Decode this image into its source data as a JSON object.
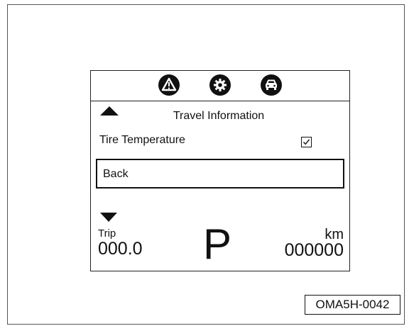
{
  "display": {
    "top_icons": [
      {
        "icon": "warning-triangle-icon"
      },
      {
        "icon": "gear-settings-icon"
      },
      {
        "icon": "car-icon"
      }
    ],
    "menu_title": "Travel Information",
    "items": [
      {
        "label": "Tire Temperature",
        "checked": true
      },
      {
        "label": "Back"
      }
    ],
    "trip_label": "Trip",
    "trip_value": "000.0",
    "gear": "P",
    "odometer_unit": "km",
    "odometer_value": "000000"
  },
  "figure_code": "OMA5H-0042"
}
